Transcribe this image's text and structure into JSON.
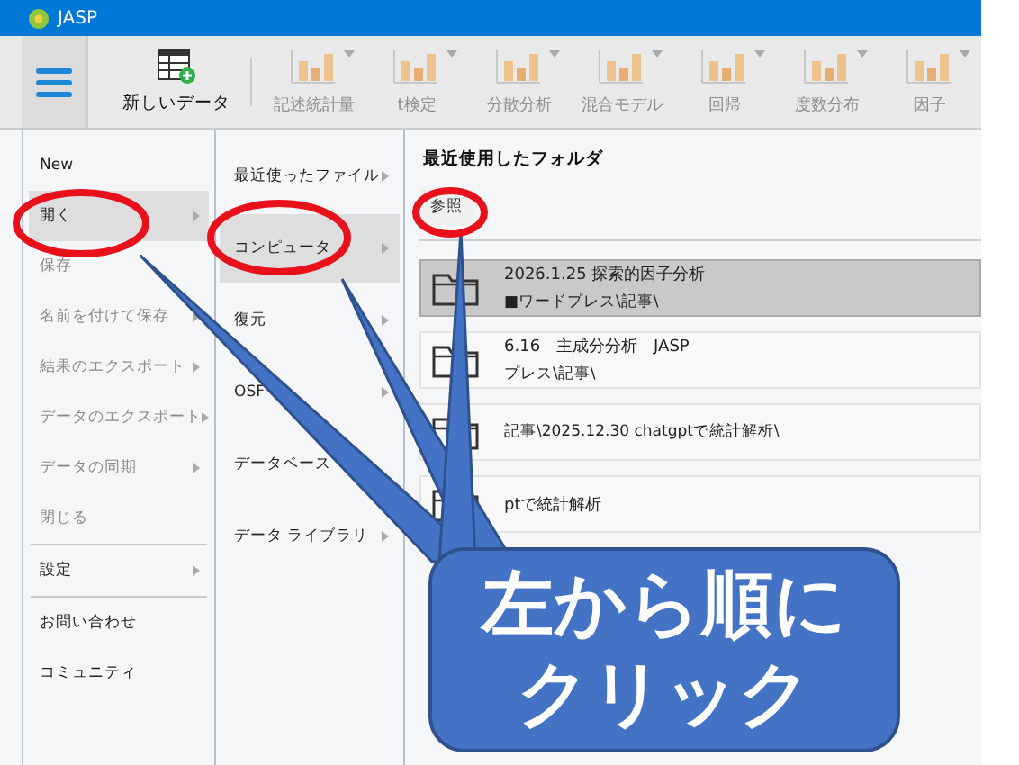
{
  "window": {
    "title": "JASP"
  },
  "toolbar": {
    "new_data": "新しいデータ",
    "tools": [
      {
        "label": "記述統計量",
        "disabled": true
      },
      {
        "label": "t検定",
        "disabled": true
      },
      {
        "label": "分散分析",
        "disabled": true
      },
      {
        "label": "混合モデル",
        "disabled": true
      },
      {
        "label": "回帰",
        "disabled": true
      },
      {
        "label": "度数分布",
        "disabled": true
      },
      {
        "label": "因子",
        "disabled": true
      }
    ]
  },
  "file_menu": {
    "groups": [
      [
        {
          "label": "New",
          "selected": false,
          "disabled": false,
          "submenu": false
        },
        {
          "label": "開く",
          "selected": true,
          "disabled": false,
          "submenu": true
        },
        {
          "label": "保存",
          "selected": false,
          "disabled": true,
          "submenu": false
        },
        {
          "label": "名前を付けて保存",
          "selected": false,
          "disabled": true,
          "submenu": true
        },
        {
          "label": "結果のエクスポート",
          "selected": false,
          "disabled": true,
          "submenu": true
        },
        {
          "label": "データのエクスポート",
          "selected": false,
          "disabled": true,
          "submenu": true
        },
        {
          "label": "データの同期",
          "selected": false,
          "disabled": true,
          "submenu": true
        },
        {
          "label": "閉じる",
          "selected": false,
          "disabled": true,
          "submenu": false
        }
      ],
      [
        {
          "label": "設定",
          "selected": false,
          "disabled": false,
          "submenu": true
        }
      ],
      [
        {
          "label": "お問い合わせ",
          "selected": false,
          "disabled": false,
          "submenu": false
        },
        {
          "label": "コミュニティ",
          "selected": false,
          "disabled": false,
          "submenu": false
        }
      ]
    ]
  },
  "open_menu": [
    {
      "label": "最近使ったファイル",
      "selected": false,
      "submenu": true
    },
    {
      "label": "コンピュータ",
      "selected": true,
      "submenu": true
    },
    {
      "label": "復元",
      "selected": false,
      "submenu": true
    },
    {
      "label": "OSF",
      "selected": false,
      "submenu": true
    },
    {
      "label": "データベース",
      "selected": false,
      "submenu": false
    },
    {
      "label": "データ ライブラリ",
      "selected": false,
      "submenu": true
    }
  ],
  "folders": {
    "heading": "最近使用したフォルダ",
    "browse": "参照",
    "rows": [
      {
        "title": "2026.1.25 探索的因子分析",
        "path": "■ワードプレス\\記事\\",
        "selected": true
      },
      {
        "title": "6.16　主成分分析　JASP",
        "path": "プレス\\記事\\",
        "selected": false
      },
      {
        "path": "記事\\2025.12.30 chatgptで統計解析\\",
        "selected": false
      },
      {
        "title": "ptで統計解析",
        "selected": false
      }
    ]
  },
  "callout": {
    "lines": [
      "左から順に",
      "クリック"
    ]
  }
}
